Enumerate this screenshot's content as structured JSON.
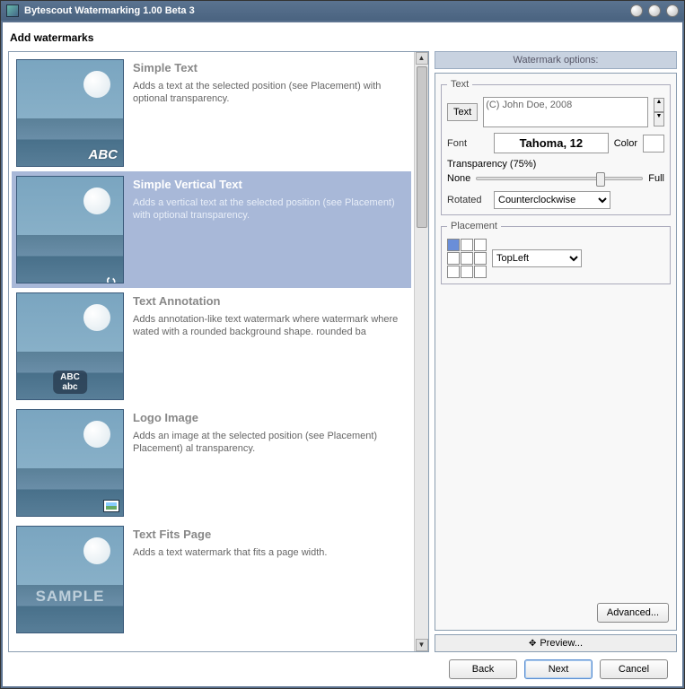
{
  "titlebar": {
    "title": "Bytescout Watermarking 1.00 Beta 3"
  },
  "header": "Add watermarks",
  "watermarks": [
    {
      "title": "Simple Text",
      "desc": "Adds a text at the selected position (see Placement) with optional transparency.",
      "overlay": "ABC",
      "kind": "text"
    },
    {
      "title": "Simple Vertical Text",
      "desc": "Adds a vertical text at the selected position (see Placement) with optional transparency.",
      "overlay": "ABC",
      "kind": "vert",
      "selected": true
    },
    {
      "title": "Text Annotation",
      "desc": "Adds annotation-like text watermark where watermark where wated with a rounded background shape. rounded ba",
      "overlay": "ABC\nabc",
      "kind": "annot"
    },
    {
      "title": "Logo Image",
      "desc": "Adds an image at the selected position (see Placement) Placement) al transparency.",
      "overlay": "",
      "kind": "logo"
    },
    {
      "title": "Text Fits Page",
      "desc": "Adds a text watermark that fits a page width.",
      "overlay": "SAMPLE",
      "kind": "sample"
    }
  ],
  "options": {
    "header": "Watermark options:",
    "text_group": "Text",
    "text_btn": "Text",
    "text_value": "(C) John Doe, 2008",
    "font_label": "Font",
    "font_display": "Tahoma, 12",
    "color_label": "Color",
    "transparency_label": "Transparency (75%)",
    "trans_none": "None",
    "trans_full": "Full",
    "slider_pct": 75,
    "rotated_label": "Rotated",
    "rotated_value": "Counterclockwise",
    "placement_group": "Placement",
    "placement_value": "TopLeft",
    "advanced": "Advanced...",
    "preview": "Preview..."
  },
  "footer": {
    "back": "Back",
    "next": "Next",
    "cancel": "Cancel"
  }
}
